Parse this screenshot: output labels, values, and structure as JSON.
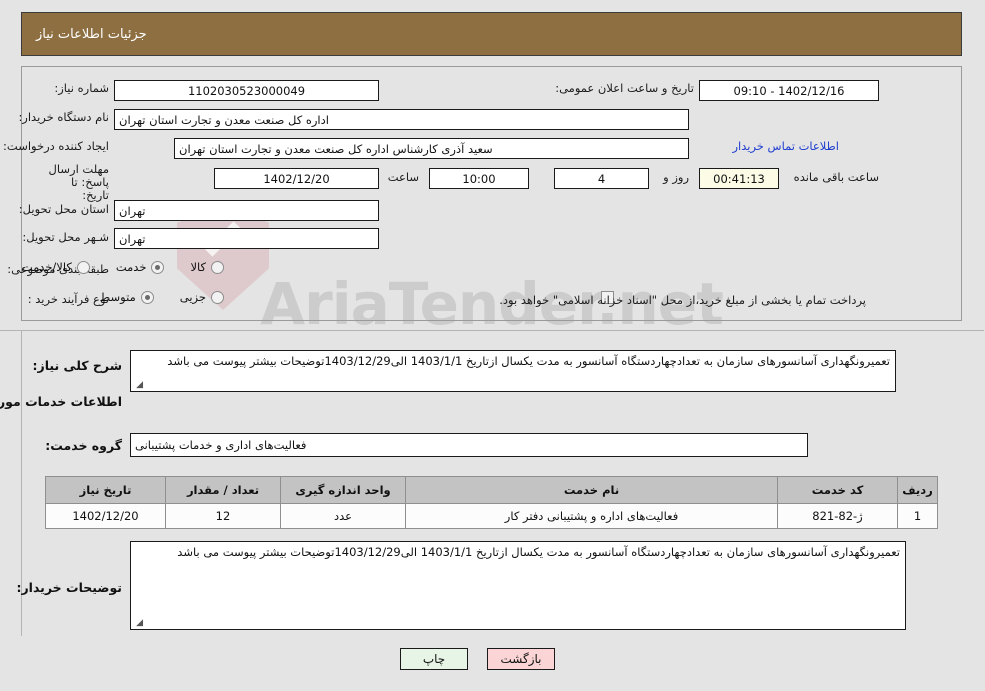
{
  "header": {
    "title": "جزئیات اطلاعات نیاز"
  },
  "form": {
    "need_number_label": "شماره نیاز:",
    "need_number_value": "1102030523000049",
    "announce_label": "تاریخ و ساعت اعلان عمومی:",
    "announce_value": "1402/12/16 - 09:10",
    "buyer_org_label": "نام دستگاه خریدار:",
    "buyer_org_value": "اداره کل صنعت  معدن و تجارت استان تهران",
    "creator_label": "ایجاد کننده درخواست:",
    "creator_value": "سعید آذری کارشناس اداره کل صنعت  معدن و تجارت استان تهران",
    "contact_link": "اطلاعات تماس خریدار",
    "deadline_label_line1": "مهلت ارسال پاسخ: تا",
    "deadline_label_line2": "تاریخ:",
    "deadline_date": "1402/12/20",
    "deadline_hour_label": "ساعت",
    "deadline_hour": "10:00",
    "remaining_days": "4",
    "remaining_days_suffix": "روز و",
    "remaining_timer": "00:41:13",
    "remaining_timer_suffix": "ساعت باقی مانده",
    "province_label": "استان محل تحویل:",
    "province_value": "تهران",
    "city_label": "شـهر محل تحویل:",
    "city_value": "تهران",
    "category_label": "طبقه بندی موضوعی:",
    "category_options": [
      {
        "label": "کالا",
        "selected": false
      },
      {
        "label": "خدمت",
        "selected": true
      },
      {
        "label": "کالا/خدمت",
        "selected": false
      }
    ],
    "process_label": "نوع فرآیند خرید :",
    "process_options": [
      {
        "label": "جزیی",
        "selected": false
      },
      {
        "label": "متوسط",
        "selected": true
      }
    ],
    "treasury_checkbox_checked": false,
    "treasury_note": "پرداخت تمام یا بخشی از مبلغ خرید،از محل \"اسناد خزانه اسلامی\" خواهد بود."
  },
  "description": {
    "label": "شرح کلی نیاز:",
    "text": "تعمیرونگهداری آسانسورهای سازمان به تعدادچهاردستگاه آسانسور به مدت یکسال ازتاریخ 1403/1/1 الی1403/12/29توضیحات بیشتر پیوست می باشد"
  },
  "services_section": {
    "heading": "اطلاعات خدمات مورد نیاز",
    "group_label": "گروه خدمت:",
    "group_value": "فعالیت‌های اداری و خدمات پشتیبانی"
  },
  "table": {
    "columns": [
      "ردیف",
      "کد خدمت",
      "نام خدمت",
      "واحد اندازه گیری",
      "تعداد / مقدار",
      "تاریخ نیاز"
    ],
    "rows": [
      {
        "index": "1",
        "code": "ژ-82-821",
        "name": "فعالیت‌های اداره و پشتیبانی دفتر کار",
        "unit": "عدد",
        "quantity": "12",
        "date": "1402/12/20"
      }
    ]
  },
  "buyer_notes": {
    "label": "توضیحات خریدار:",
    "text": "تعمیرونگهداری آسانسورهای سازمان به تعدادچهاردستگاه آسانسور به مدت یکسال ازتاریخ 1403/1/1 الی1403/12/29توضیحات بیشتر پیوست می باشد"
  },
  "buttons": {
    "print": "چاپ",
    "back": "بازگشت"
  },
  "watermark": {
    "text": "AriaTender.net"
  },
  "colors": {
    "header_brown": "#8d6f42",
    "page_background": "#e4e4e4",
    "link_blue": "#1f3fd0",
    "timer_background": "#fbfbe6",
    "print_button": "#e7f5e7",
    "back_button": "#fbd5d5",
    "table_header": "#c3c3c3"
  }
}
